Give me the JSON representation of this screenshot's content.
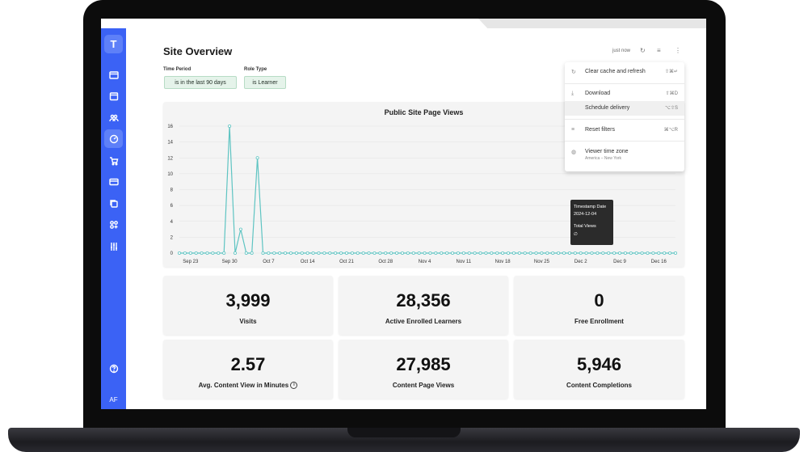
{
  "sidebar": {
    "logo": "T",
    "initials": "AF",
    "items": [
      {
        "icon": "browser-window-icon"
      },
      {
        "icon": "calendar-icon"
      },
      {
        "icon": "users-icon"
      },
      {
        "icon": "dashboard-gauge-icon"
      },
      {
        "icon": "shopping-cart-icon"
      },
      {
        "icon": "credit-card-icon"
      },
      {
        "icon": "copy-icon"
      },
      {
        "icon": "apps-grid-icon"
      },
      {
        "icon": "sliders-icon"
      }
    ],
    "help_icon": "help-circle-icon"
  },
  "header": {
    "title": "Site Overview",
    "refresh_time": "just now"
  },
  "filters": [
    {
      "label": "Time Period",
      "value": "is in the last 90 days"
    },
    {
      "label": "Role Type",
      "value": "is Learner"
    }
  ],
  "menu": {
    "items": [
      {
        "icon": "refresh-icon",
        "label": "Clear cache and refresh",
        "shortcut": "⇧⌘↵"
      },
      {
        "icon": "download-icon",
        "label": "Download",
        "shortcut": "⇧⌘D"
      },
      {
        "icon": "",
        "label": "Schedule delivery",
        "shortcut": "⌥⇧S"
      },
      {
        "icon": "filter-icon",
        "label": "Reset filters",
        "shortcut": "⌘⌥R"
      },
      {
        "icon": "globe-icon",
        "label": "Viewer time zone",
        "sub": "America – New York"
      }
    ]
  },
  "tooltip": {
    "k1": "Timestamp Date",
    "v1": "2024-12-04",
    "k2": "Total Views",
    "v2": "∅"
  },
  "kpis": [
    {
      "value": "3,999",
      "label": "Visits"
    },
    {
      "value": "28,356",
      "label": "Active Enrolled Learners"
    },
    {
      "value": "0",
      "label": "Free Enrollment"
    },
    {
      "value": "2.57",
      "label": "Avg. Content View in Minutes"
    },
    {
      "value": "27,985",
      "label": "Content Page Views"
    },
    {
      "value": "5,946",
      "label": "Content Completions"
    }
  ],
  "colors": {
    "accent": "#3b62f5",
    "line": "#5ec4c2"
  },
  "chart_data": {
    "type": "line",
    "title": "Public Site Page Views",
    "xlabel": "",
    "ylabel": "",
    "ylim": [
      0,
      16
    ],
    "yticks": [
      0,
      2,
      4,
      6,
      8,
      10,
      12,
      14,
      16
    ],
    "x_tick_labels": [
      "Sep 23",
      "Sep 30",
      "Oct 7",
      "Oct 14",
      "Oct 21",
      "Oct 28",
      "Nov 4",
      "Nov 11",
      "Nov 18",
      "Nov 25",
      "Dec 2",
      "Dec 9",
      "Dec 16"
    ],
    "grid": true,
    "series": [
      {
        "values": [
          0,
          0,
          0,
          0,
          0,
          0,
          0,
          0,
          0,
          16,
          0,
          3,
          0,
          0,
          12,
          0,
          0,
          0,
          0,
          0,
          0,
          0,
          0,
          0,
          0,
          0,
          0,
          0,
          0,
          0,
          0,
          0,
          0,
          0,
          0,
          0,
          0,
          0,
          0,
          0,
          0,
          0,
          0,
          0,
          0,
          0,
          0,
          0,
          0,
          0,
          0,
          0,
          0,
          0,
          0,
          0,
          0,
          0,
          0,
          0,
          0,
          0,
          0,
          0,
          0,
          0,
          0,
          0,
          0,
          0,
          0,
          0,
          0,
          0,
          0,
          0,
          0,
          0,
          0,
          0,
          0,
          0,
          0,
          0,
          0,
          0,
          0,
          0,
          0,
          0
        ]
      }
    ]
  }
}
